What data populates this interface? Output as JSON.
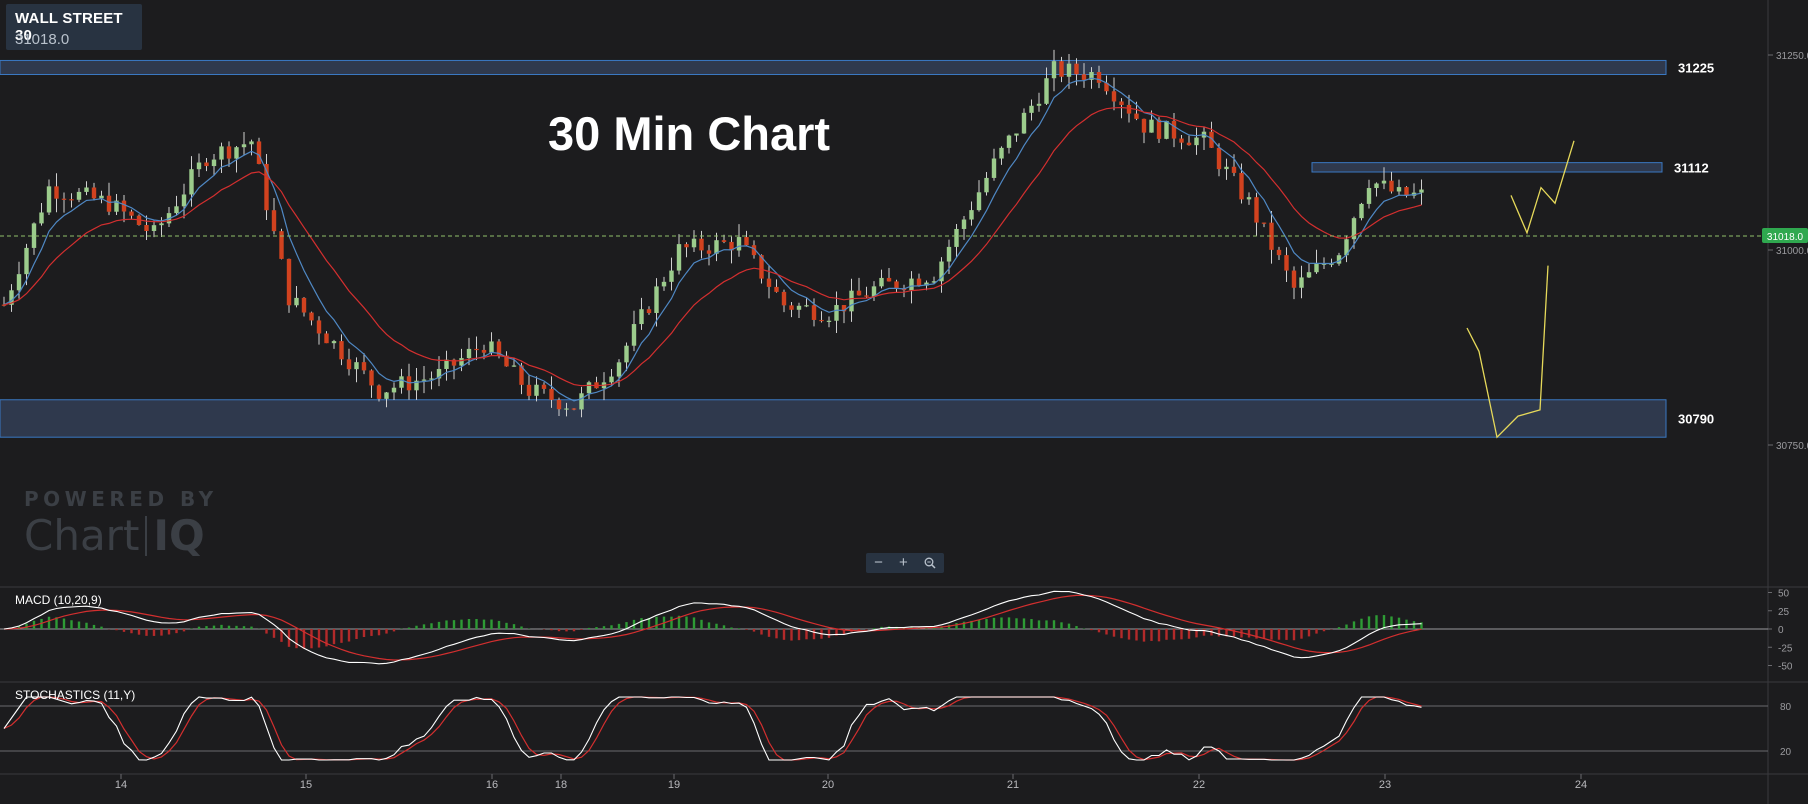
{
  "instrument": {
    "name": "WALL STREET 30",
    "price": "31018.0"
  },
  "overlay_title": "30 Min Chart",
  "branding": {
    "line1": "POWERED BY",
    "word": "Chart",
    "mark": "IQ"
  },
  "zoom_controls": {
    "zoom_out": "−",
    "zoom_in": "+",
    "zoom_reset_icon": "zoom-reset-icon"
  },
  "colors": {
    "background": "#1c1c1e",
    "candle_up": "#9ccc8c",
    "candle_down": "#d1421f",
    "ma_fast": "#4f88c4",
    "ma_slow": "#d32f2f",
    "zone_fill": "#333e56",
    "zone_stroke": "#3a78c2",
    "projection": "#e6d95a",
    "current_price": "#2fa84f"
  },
  "chart_data": [
    {
      "type": "candlestick",
      "title": "",
      "x_ticks": [
        "14",
        "15",
        "16",
        "18",
        "19",
        "20",
        "21",
        "22",
        "23",
        "24"
      ],
      "y_ticks": [
        "31250.0",
        "31000.0",
        "30750.0"
      ],
      "ylim": [
        30610,
        31290
      ],
      "current_price": 31018.0,
      "current_price_label": "31018.0",
      "approx_close_path": [
        [
          0,
          30930
        ],
        [
          6,
          31080
        ],
        [
          14,
          31060
        ],
        [
          20,
          31020
        ],
        [
          27,
          31120
        ],
        [
          33,
          31140
        ],
        [
          38,
          30940
        ],
        [
          44,
          30880
        ],
        [
          50,
          30820
        ],
        [
          58,
          30840
        ],
        [
          64,
          30880
        ],
        [
          70,
          30820
        ],
        [
          76,
          30800
        ],
        [
          82,
          30860
        ],
        [
          90,
          31000
        ],
        [
          98,
          31010
        ],
        [
          104,
          30930
        ],
        [
          110,
          30920
        ],
        [
          116,
          30950
        ],
        [
          124,
          30970
        ],
        [
          132,
          31110
        ],
        [
          140,
          31230
        ],
        [
          146,
          31225
        ],
        [
          152,
          31160
        ],
        [
          160,
          31140
        ],
        [
          166,
          31060
        ],
        [
          172,
          30950
        ],
        [
          178,
          31000
        ],
        [
          182,
          31090
        ],
        [
          186,
          31070
        ]
      ],
      "levels": [
        {
          "label": "31225",
          "low": 31225,
          "high": 31243
        },
        {
          "label": "31112",
          "low": 31100,
          "high": 31112
        },
        {
          "label": "30790",
          "low": 30760,
          "high": 30808
        }
      ],
      "projection": {
        "a": [
          [
            31012,
            30900
          ],
          [
            30963,
            30870
          ],
          [
            30945,
            30760
          ],
          [
            30719,
            30787
          ],
          [
            30807,
            30795
          ],
          [
            30968,
            30980
          ]
        ],
        "b": [
          [
            31018,
            31070
          ],
          [
            31032,
            31022
          ],
          [
            31057,
            31080
          ],
          [
            31085,
            31060
          ],
          [
            31100,
            31140
          ]
        ]
      }
    },
    {
      "type": "line",
      "title": "MACD (10,20,9)",
      "y_ticks": [
        "50",
        "25",
        "0",
        "-25",
        "-50"
      ],
      "ylim": [
        -70,
        70
      ],
      "series": [
        {
          "name": "MACD"
        },
        {
          "name": "Signal"
        },
        {
          "name": "Histogram"
        }
      ]
    },
    {
      "type": "line",
      "title": "STOCHASTICS (11,Y)",
      "y_ticks": [
        "80",
        "20"
      ],
      "ylim": [
        0,
        100
      ],
      "series": [
        {
          "name": "%K"
        },
        {
          "name": "%D"
        }
      ]
    }
  ]
}
